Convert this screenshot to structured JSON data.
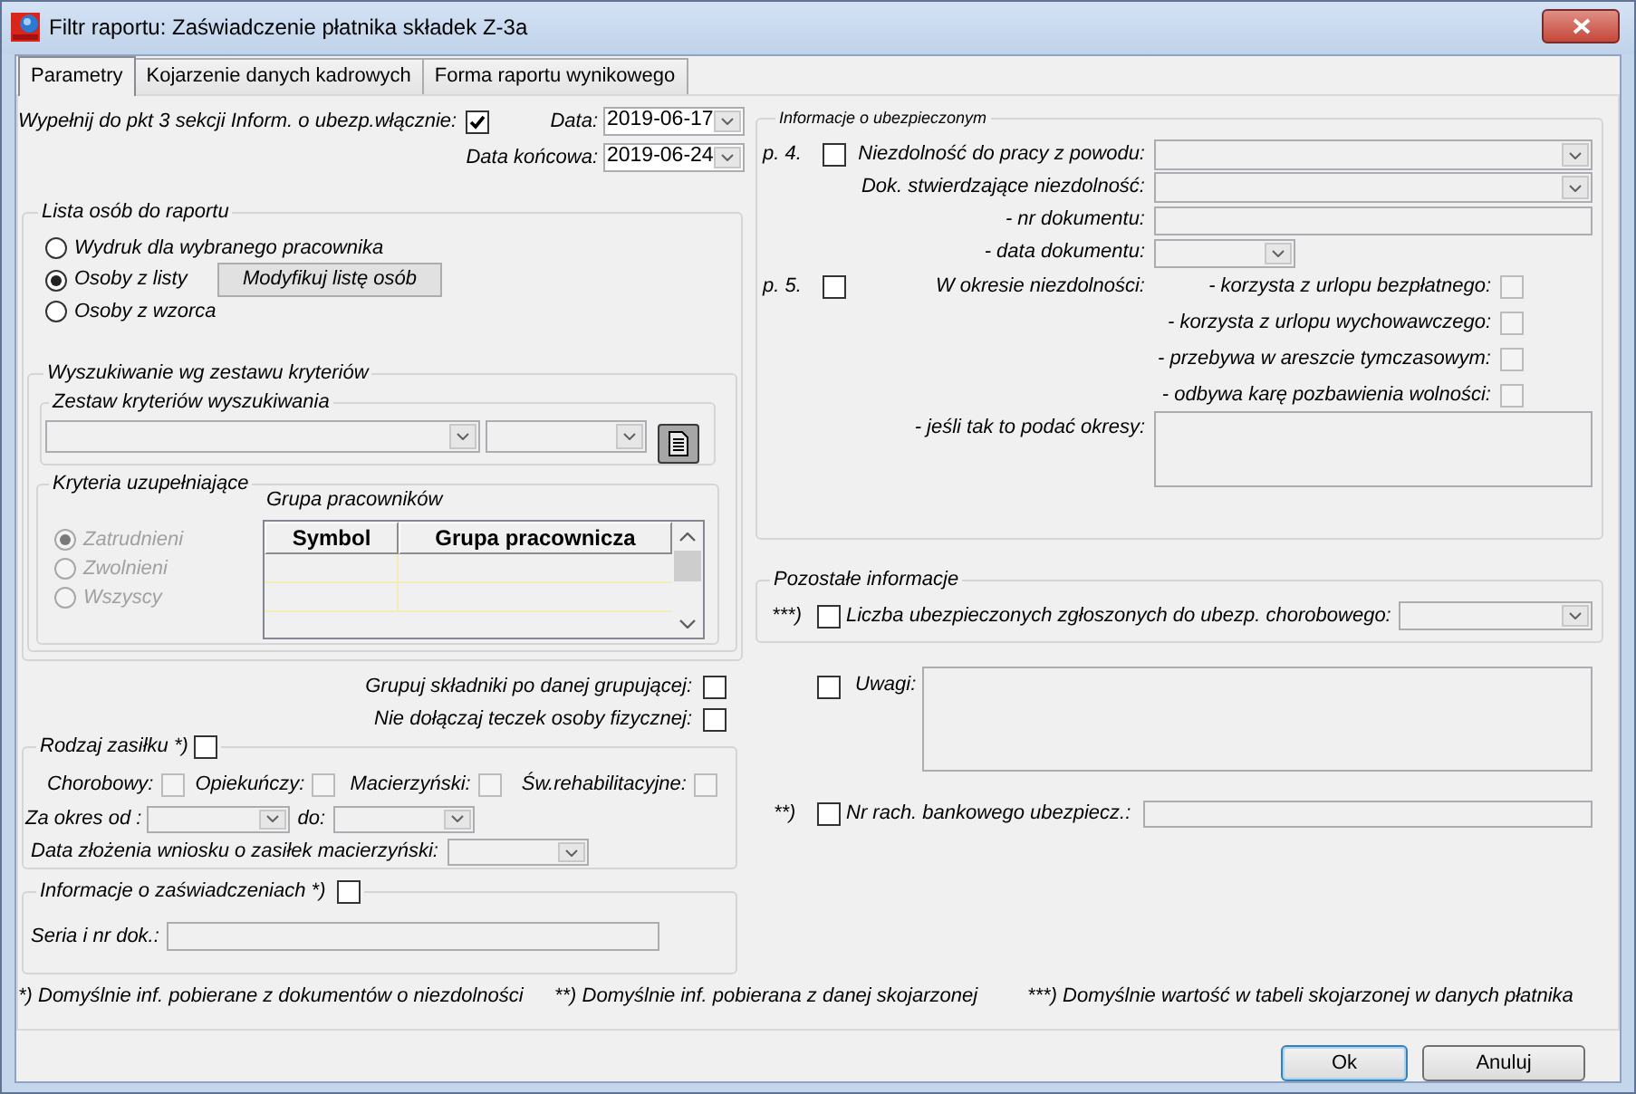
{
  "window": {
    "title": "Filtr raportu: Zaświadczenie płatnika składek Z-3a"
  },
  "tabs": [
    {
      "label": "Parametry",
      "selected": true
    },
    {
      "label": "Kojarzenie danych kadrowych",
      "selected": false
    },
    {
      "label": "Forma raportu wynikowego",
      "selected": false
    }
  ],
  "general": {
    "fill_to_pt3": {
      "label": "Wypełnij do pkt 3 sekcji Inform. o ubezp.włącznie:",
      "checked": true
    },
    "date": {
      "label": "Data:",
      "value": "2019-06-17"
    },
    "end_date": {
      "label": "Data końcowa:",
      "value": "2019-06-24"
    }
  },
  "person_list": {
    "title": "Lista osób do raportu",
    "options": [
      {
        "label": "Wydruk dla wybranego pracownika",
        "selected": false
      },
      {
        "label": "Osoby z listy",
        "selected": true
      },
      {
        "label": "Osoby z wzorca",
        "selected": false
      }
    ],
    "modify_button": "Modyfikuj listę osób",
    "criteria_search": {
      "title": "Wyszukiwanie wg zestawu kryteriów",
      "criteria_set_title": "Zestaw kryteriów wyszukiwania",
      "supplementary": {
        "title": "Kryteria uzupełniające",
        "options": [
          {
            "label": "Zatrudnieni",
            "selected": true,
            "disabled": true
          },
          {
            "label": "Zwolnieni",
            "selected": false,
            "disabled": true
          },
          {
            "label": "Wszyscy",
            "selected": false,
            "disabled": true
          }
        ],
        "employee_group": {
          "title": "Grupa pracowników",
          "columns": [
            "Symbol",
            "Grupa pracownicza"
          ]
        }
      }
    }
  },
  "options": [
    {
      "label": "Grupuj składniki po danej grupującej:",
      "checked": false
    },
    {
      "label": "Nie dołączaj teczek osoby fizycznej:",
      "checked": false
    }
  ],
  "benefit_type": {
    "title": "Rodzaj zasiłku *)",
    "checked": false,
    "types": [
      {
        "label": "Chorobowy:",
        "checked": false,
        "disabled": true
      },
      {
        "label": "Opiekuńczy:",
        "checked": false,
        "disabled": true
      },
      {
        "label": "Macierzyński:",
        "checked": false,
        "disabled": true
      },
      {
        "label": "Św.rehabilitacyjne:",
        "checked": false,
        "disabled": true
      }
    ],
    "period_from_label": "Za okres od :",
    "period_to_label": "do:",
    "application_date_label": "Data złożenia wniosku o zasiłek macierzyński:"
  },
  "certificates": {
    "title": "Informacje o zaświadczeniach *)",
    "checked": false,
    "series_label": "Seria i nr dok.:"
  },
  "insured_info": {
    "title": "Informacje o ubezpieczonym",
    "p4": {
      "prefix": "p. 4.",
      "checked": false,
      "reason_label": "Niezdolność do pracy z powodu:",
      "document_label": "Dok. stwierdzające niezdolność:",
      "number_label": "- nr dokumentu:",
      "date_label": "- data dokumentu:"
    },
    "p5": {
      "prefix": "p. 5.",
      "checked": false,
      "label": "W okresie niezdolności:",
      "conditions": [
        {
          "label": "- korzysta z urlopu bezpłatnego:",
          "checked": false,
          "disabled": true
        },
        {
          "label": "- korzysta z urlopu wychowawczego:",
          "checked": false,
          "disabled": true
        },
        {
          "label": "- przebywa w areszcie tymczasowym:",
          "checked": false,
          "disabled": true
        },
        {
          "label": "- odbywa karę pozbawienia wolności:",
          "checked": false,
          "disabled": true
        }
      ],
      "periods_label": "- jeśli tak to podać okresy:"
    }
  },
  "other_info": {
    "title": "Pozostałe informacje",
    "insured_count": {
      "prefix": "***)",
      "label": "Liczba ubezpieczonych zgłoszonych do ubezp. chorobowego:",
      "checked": false
    }
  },
  "remarks": {
    "label": "Uwagi:",
    "checked": false
  },
  "bank_account": {
    "prefix": "**)",
    "label": "Nr rach. bankowego ubezpiecz.:",
    "checked": false
  },
  "footnotes": [
    "*) Domyślnie inf. pobierane z dokumentów o niezdolności",
    "**) Domyślnie inf. pobierana z danej skojarzonej",
    "***) Domyślnie wartość w tabeli skojarzonej w danych płatnika"
  ],
  "buttons": [
    {
      "label": "Ok",
      "default": true
    },
    {
      "label": "Anuluj",
      "default": false
    }
  ]
}
